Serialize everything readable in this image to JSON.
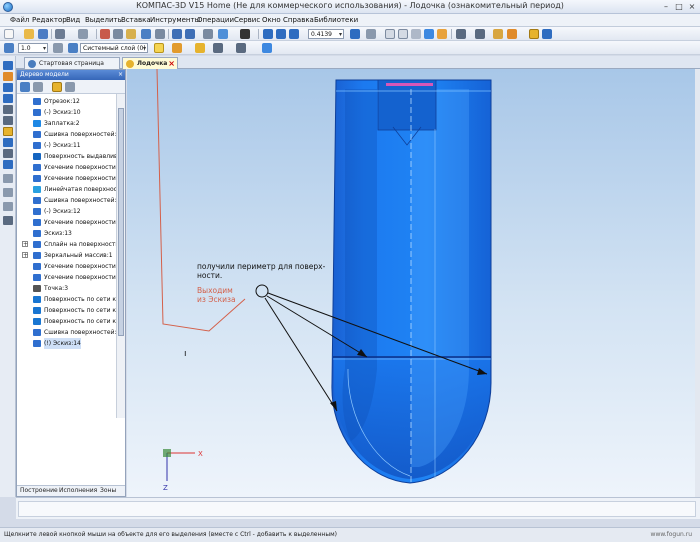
{
  "window": {
    "title": "КОМПАС-3D V15 Home (Не для коммерческого использования) - Лодочка (ознакомительный период)",
    "controls": [
      "–",
      "□",
      "×"
    ]
  },
  "menu": [
    "Файл",
    "Редактор",
    "Вид",
    "Выделить",
    "Вставка",
    "Инструменты",
    "Операции",
    "Сервис",
    "Окно",
    "Справка",
    "Библиотеки"
  ],
  "toolbar": {
    "scale_value": "0.4139",
    "line_width": "1.0",
    "layer": "Системный слой (0)"
  },
  "tabs": [
    {
      "label": "Стартовая страница",
      "active": false
    },
    {
      "label": "Лодочка",
      "active": true
    }
  ],
  "tree": {
    "header": "Дерево модели",
    "close": "×",
    "items": [
      {
        "label": "Отрезок:12",
        "icon": "segment-icon",
        "color": "#2f6fcf"
      },
      {
        "label": "(-) Эскиз:10",
        "icon": "sketch-icon",
        "color": "#2f6fcf"
      },
      {
        "label": "Заплатка:2",
        "icon": "patch-icon",
        "color": "#1e88e5"
      },
      {
        "label": "Сшивка поверхностей:5",
        "icon": "stitch-icon",
        "color": "#2f6fcf"
      },
      {
        "label": "(-) Эскиз:11",
        "icon": "sketch-icon",
        "color": "#2f6fcf"
      },
      {
        "label": "Поверхность выдавливания",
        "icon": "extrude-surface-icon",
        "color": "#1565c0"
      },
      {
        "label": "Усечение поверхности:",
        "icon": "trim-surface-icon",
        "color": "#2f6fcf"
      },
      {
        "label": "Усечение поверхности:",
        "icon": "trim-surface-icon",
        "color": "#2f6fcf"
      },
      {
        "label": "Линейчатая поверхность",
        "icon": "ruled-surface-icon",
        "color": "#29a0e0"
      },
      {
        "label": "Сшивка поверхностей:6",
        "icon": "stitch-icon",
        "color": "#2f6fcf"
      },
      {
        "label": "(-) Эскиз:12",
        "icon": "sketch-icon",
        "color": "#2f6fcf"
      },
      {
        "label": "Усечение поверхности:",
        "icon": "trim-surface-icon",
        "color": "#2f6fcf"
      },
      {
        "label": "Эскиз:13",
        "icon": "sketch-icon",
        "color": "#2f6fcf"
      },
      {
        "label": "Сплайн на поверхности",
        "icon": "spline-icon",
        "color": "#2f6fcf",
        "expander": "+"
      },
      {
        "label": "Зеркальный массив:1",
        "icon": "mirror-icon",
        "color": "#2f6fcf",
        "expander": "+"
      },
      {
        "label": "Усечение поверхности:",
        "icon": "trim-surface-icon",
        "color": "#2f6fcf"
      },
      {
        "label": "Усечение поверхности:",
        "icon": "trim-surface-icon",
        "color": "#2f6fcf"
      },
      {
        "label": "Точка:3",
        "icon": "point-icon",
        "color": "#555555"
      },
      {
        "label": "Поверхность по сети кр",
        "icon": "mesh-surface-icon",
        "color": "#1976d2"
      },
      {
        "label": "Поверхность по сети кр",
        "icon": "mesh-surface-icon",
        "color": "#1976d2"
      },
      {
        "label": "Поверхность по сети кр",
        "icon": "mesh-surface-icon",
        "color": "#1976d2"
      },
      {
        "label": "Сшивка поверхностей:9",
        "icon": "stitch-icon",
        "color": "#2f6fcf"
      },
      {
        "label": "(!) Эскиз:14",
        "icon": "sketch-icon",
        "color": "#2f6fcf",
        "selected": true
      }
    ],
    "bottom_tabs": [
      "Построение",
      "Исполнения",
      "Зоны"
    ]
  },
  "annotations": {
    "note_line1": "получили периметр для поверх-",
    "note_line2": "ности.",
    "red_line1": "Выходим",
    "red_line2": "из Эскиза",
    "cursor_mark": "ı"
  },
  "axes": {
    "x": "X",
    "z": "Z"
  },
  "status": {
    "hint": "Щелкните левой кнопкой мыши на объекте для его выделения (вместе с Ctrl - добавить к выделенным)",
    "watermark": "www.fogun.ru"
  },
  "colors": {
    "accent": "#1a7fe0",
    "model_fill": "#1e7ae6",
    "annotation_red": "#d4604a"
  }
}
